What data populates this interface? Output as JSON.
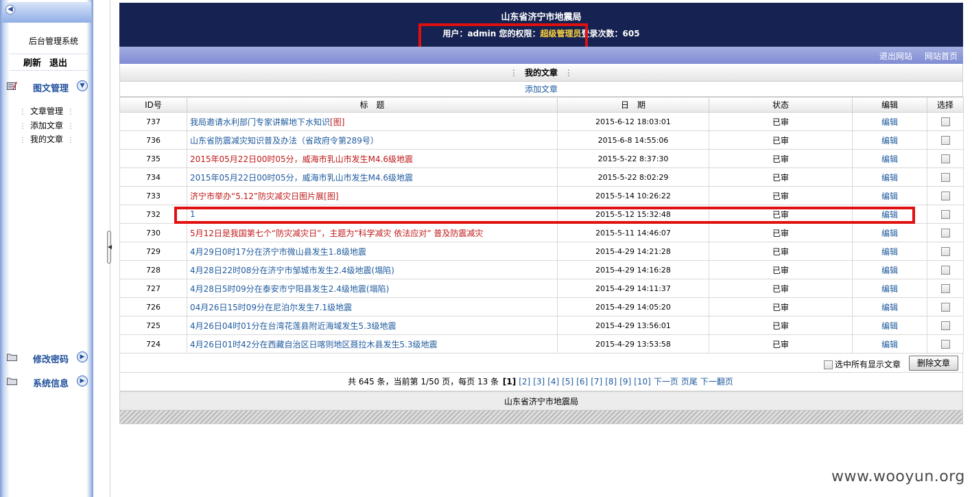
{
  "sidebar": {
    "system_name": "后台管理系统",
    "refresh": "刷新",
    "logout": "退出",
    "groups": [
      {
        "label": "图文管理",
        "icon": "article-icon",
        "expanded": true
      },
      {
        "label": "修改密码",
        "icon": "folder-icon",
        "expanded": false
      },
      {
        "label": "系统信息",
        "icon": "folder-icon",
        "expanded": false
      }
    ],
    "items": [
      {
        "label": "文章管理"
      },
      {
        "label": "添加文章"
      },
      {
        "label": "我的文章"
      }
    ]
  },
  "header": {
    "title": "山东省济宁市地震局",
    "user_label": "用户：",
    "username": "admin",
    "perm_label": " 您的权限：",
    "role": "超级管理员",
    "login_label": "登录次数：",
    "login_count": "605"
  },
  "nav": {
    "exit_site": "退出网站",
    "home": "网站首页"
  },
  "section": {
    "title": "我的文章",
    "add_link": "添加文章"
  },
  "table": {
    "headers": [
      "ID号",
      "标　题",
      "日　期",
      "状态",
      "编辑",
      "选择"
    ],
    "rows": [
      {
        "id": "737",
        "title": "我局邀请水利部门专家讲解地下水知识",
        "tag": "[图]",
        "color": "blue",
        "date": "2015-6-12 18:03:01",
        "status": "已审",
        "edit": "编辑"
      },
      {
        "id": "736",
        "title": "山东省防震减灾知识普及办法（省政府令第289号）",
        "tag": "",
        "color": "blue",
        "date": "2015-6-8 14:55:06",
        "status": "已审",
        "edit": "编辑"
      },
      {
        "id": "735",
        "title": "2015年05月22日00时05分，威海市乳山市发生M4.6级地震",
        "tag": "",
        "color": "red",
        "date": "2015-5-22 8:37:30",
        "status": "已审",
        "edit": "编辑"
      },
      {
        "id": "734",
        "title": "2015年05月22日00时05分，威海市乳山市发生M4.6级地震",
        "tag": "",
        "color": "blue",
        "date": "2015-5-22 8:02:29",
        "status": "已审",
        "edit": "编辑"
      },
      {
        "id": "733",
        "title": "济宁市举办“5.12”防灾减灾日图片展",
        "tag": "[图]",
        "color": "red",
        "date": "2015-5-14 10:26:22",
        "status": "已审",
        "edit": "编辑"
      },
      {
        "id": "732",
        "title": "1",
        "tag": "",
        "color": "blue",
        "date": "2015-5-12 15:32:48",
        "status": "已审",
        "edit": "编辑"
      },
      {
        "id": "730",
        "title": "5月12日是我国第七个“防灾减灾日”，主题为“科学减灾 依法应对” 普及防震减灾",
        "tag": "",
        "color": "red",
        "date": "2015-5-11 14:46:07",
        "status": "已审",
        "edit": "编辑"
      },
      {
        "id": "729",
        "title": "4月29日0时17分在济宁市微山县发生1.8级地震",
        "tag": "",
        "color": "blue",
        "date": "2015-4-29 14:21:28",
        "status": "已审",
        "edit": "编辑"
      },
      {
        "id": "728",
        "title": "4月28日22时08分在济宁市邹城市发生2.4级地震(塌陷)",
        "tag": "",
        "color": "blue",
        "date": "2015-4-29 14:16:28",
        "status": "已审",
        "edit": "编辑"
      },
      {
        "id": "727",
        "title": "4月28日5时09分在泰安市宁阳县发生2.4级地震(塌陷)",
        "tag": "",
        "color": "blue",
        "date": "2015-4-29 14:11:37",
        "status": "已审",
        "edit": "编辑"
      },
      {
        "id": "726",
        "title": "04月26日15时09分在尼泊尔发生7.1级地震",
        "tag": "",
        "color": "blue",
        "date": "2015-4-29 14:05:20",
        "status": "已审",
        "edit": "编辑"
      },
      {
        "id": "725",
        "title": "4月26日04时01分在台湾花莲县附近海域发生5.3级地震",
        "tag": "",
        "color": "blue",
        "date": "2015-4-29 13:56:01",
        "status": "已审",
        "edit": "编辑"
      },
      {
        "id": "724",
        "title": "4月26日01时42分在西藏自治区日喀则地区聂拉木县发生5.3级地震",
        "tag": "",
        "color": "blue",
        "date": "2015-4-29 13:53:58",
        "status": "已审",
        "edit": "编辑"
      }
    ]
  },
  "actions": {
    "select_all": "选中所有显示文章",
    "delete": "删除文章"
  },
  "pager": {
    "summary": "共 645 条，当前第 1/50 页，每页 13 条 ",
    "current": "[1]",
    "pages": [
      "[2]",
      "[3]",
      "[4]",
      "[5]",
      "[6]",
      "[7]",
      "[8]",
      "[9]",
      "[10]"
    ],
    "next": "下一页",
    "last": "页尾",
    "next_group": "下一翻页"
  },
  "footer": {
    "text": "山东省济宁市地震局"
  },
  "watermark": "www.wooyun.org",
  "colors": {
    "header_bg": "#162251",
    "role": "#ffd33b",
    "link": "#1e5a9e",
    "red_title": "#c01818",
    "highlight": "#e01010"
  }
}
